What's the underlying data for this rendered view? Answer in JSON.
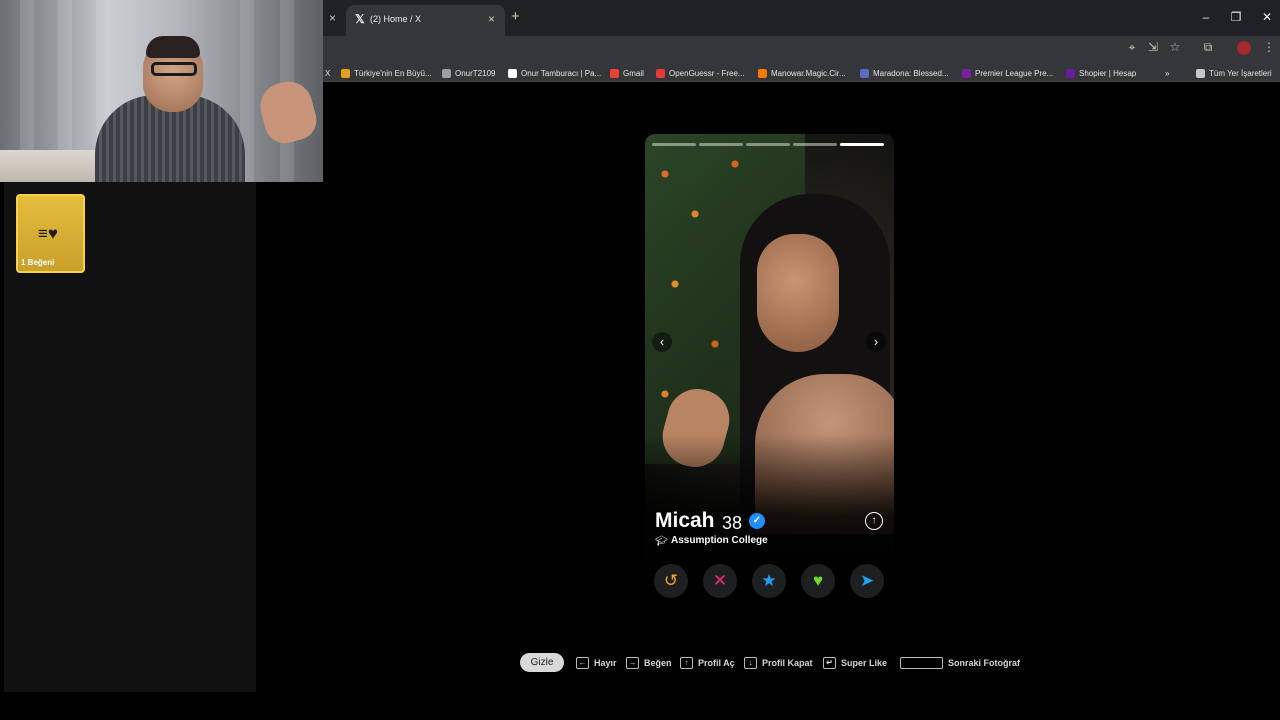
{
  "browser": {
    "active_tab_title": "(2) Home / X",
    "active_tab_icon": "x-logo-icon",
    "prev_tab_close": "×",
    "new_tab": "+",
    "window_controls": [
      "–",
      "❐",
      "✕"
    ]
  },
  "bookmarks": [
    {
      "label": "X",
      "icon": "x-icon",
      "color": "#e8eaed"
    },
    {
      "label": "Türkiye'nin En Büyü...",
      "icon": "eye-icon",
      "color": "#e6a11c"
    },
    {
      "label": "OnurT2109",
      "icon": "globe-icon",
      "color": "#9aa0a6"
    },
    {
      "label": "Onur Tamburacı | Pa...",
      "icon": "patreon-icon",
      "color": "#ffffff"
    },
    {
      "label": "Gmail",
      "icon": "gmail-icon",
      "color": "#ea4335"
    },
    {
      "label": "OpenGuessr - Free...",
      "icon": "openguessr-icon",
      "color": "#e53935"
    },
    {
      "label": "Manowar.Magic.Cir...",
      "icon": "manowar-icon",
      "color": "#f57c00"
    },
    {
      "label": "Maradona: Blessed...",
      "icon": "maradona-icon",
      "color": "#5c6bc0"
    },
    {
      "label": "Premier League Pre...",
      "icon": "premier-league-icon",
      "color": "#7b1fa2"
    },
    {
      "label": "Shopier | Hesap",
      "icon": "shopier-icon",
      "color": "#6a1b9a"
    },
    {
      "label": "»",
      "icon": "more-bookmarks-icon",
      "color": "#c4c7c5"
    },
    {
      "label": "Tüm Yer İşaretleri",
      "icon": "folder-icon",
      "color": "#c4c7c5"
    }
  ],
  "left_panel": {
    "like_card_label": "1 Beğeni",
    "accent": "#f4d34a"
  },
  "profile": {
    "name": "Micah",
    "age": "38",
    "verified": true,
    "school": "Assumption College",
    "photo_count": 5,
    "active_photo": 5,
    "expand_icon": "↑",
    "prev_icon": "‹",
    "next_icon": "›"
  },
  "actions": [
    {
      "name": "rewind-button",
      "icon": "rewind-icon",
      "glyph": "↺",
      "color": "#f5a623"
    },
    {
      "name": "nope-button",
      "icon": "x-icon",
      "glyph": "✕",
      "color": "#fd267d"
    },
    {
      "name": "super-like-button",
      "icon": "star-icon",
      "glyph": "★",
      "color": "#1ea1f2"
    },
    {
      "name": "like-button",
      "icon": "heart-icon",
      "glyph": "♥",
      "color": "#76d72d"
    },
    {
      "name": "boost-button",
      "icon": "send-icon",
      "glyph": "➤",
      "color": "#1ea1f2"
    }
  ],
  "shortcuts": {
    "hide_label": "Gizle",
    "items": [
      {
        "key": "←",
        "label": "Hayır"
      },
      {
        "key": "→",
        "label": "Beğen"
      },
      {
        "key": "↑",
        "label": "Profil Aç"
      },
      {
        "key": "↓",
        "label": "Profil Kapat"
      },
      {
        "key": "↵",
        "label": "Super Like"
      },
      {
        "key": "",
        "label": "Sonraki Fotoğraf"
      }
    ]
  }
}
